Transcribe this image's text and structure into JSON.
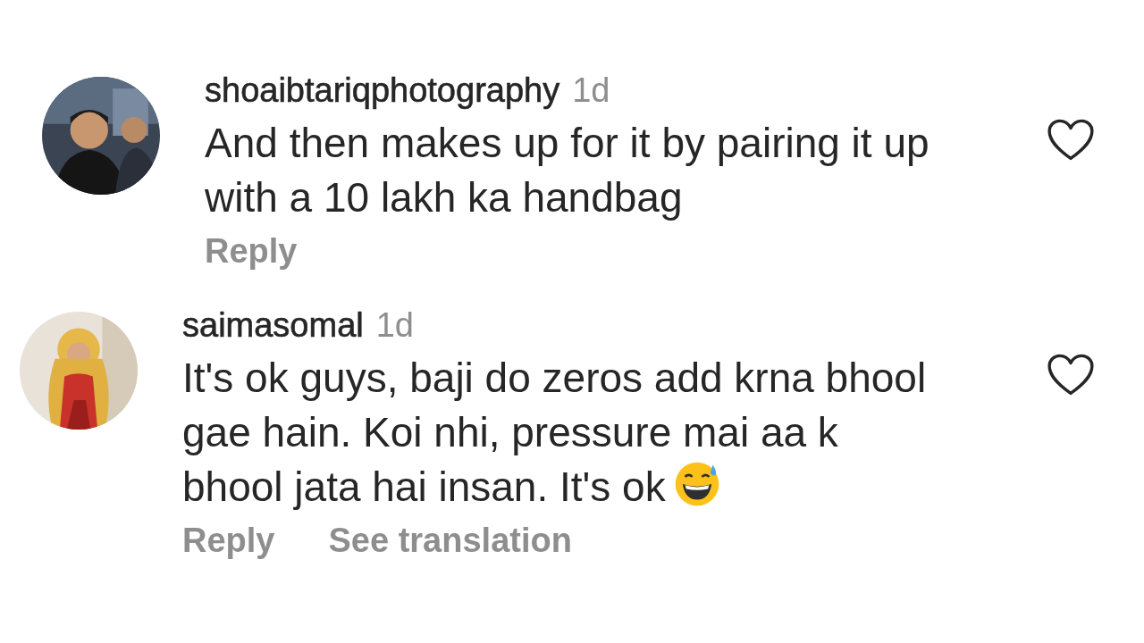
{
  "comments": [
    {
      "username": "shoaibtariqphotography",
      "time": "1d",
      "text": "And then makes up for it by pairing it up with a 10 lakh ka handbag",
      "emoji": false,
      "liked": false,
      "actions": [
        "Reply"
      ]
    },
    {
      "username": "saimasomal",
      "time": "1d",
      "text": "It's ok guys, baji do zeros add krna bhool gae hain. Koi nhi, pressure mai aa k bhool jata hai insan. It's ok",
      "emoji": true,
      "liked": false,
      "actions": [
        "Reply",
        "See translation"
      ]
    }
  ]
}
